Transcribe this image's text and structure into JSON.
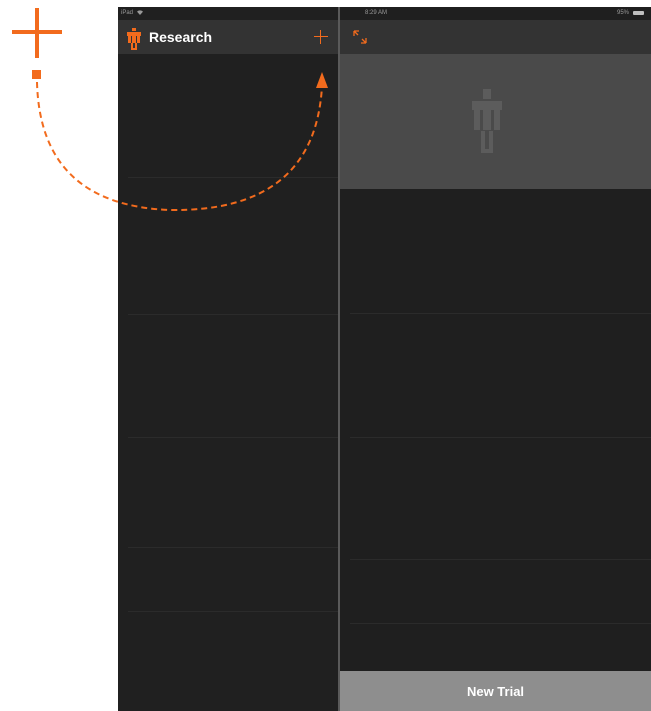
{
  "status_bar": {
    "carrier": "iPad",
    "time": "8:29 AM",
    "battery": "95%"
  },
  "master": {
    "title": "Research",
    "add_icon": "plus-icon",
    "logo_icon": "robot-logo-icon"
  },
  "detail": {
    "expand_icon": "expand-icon",
    "placeholder_icon": "robot-logo-icon",
    "new_trial_label": "New Trial"
  },
  "annotation": {
    "callout_icon": "plus-icon",
    "arrow": "dashed-curved-arrow"
  },
  "colors": {
    "accent": "#f26b1d",
    "background": "#1f1f1f",
    "navbar": "#333333",
    "hero": "#4a4a4a",
    "button": "#8e8e8e"
  }
}
